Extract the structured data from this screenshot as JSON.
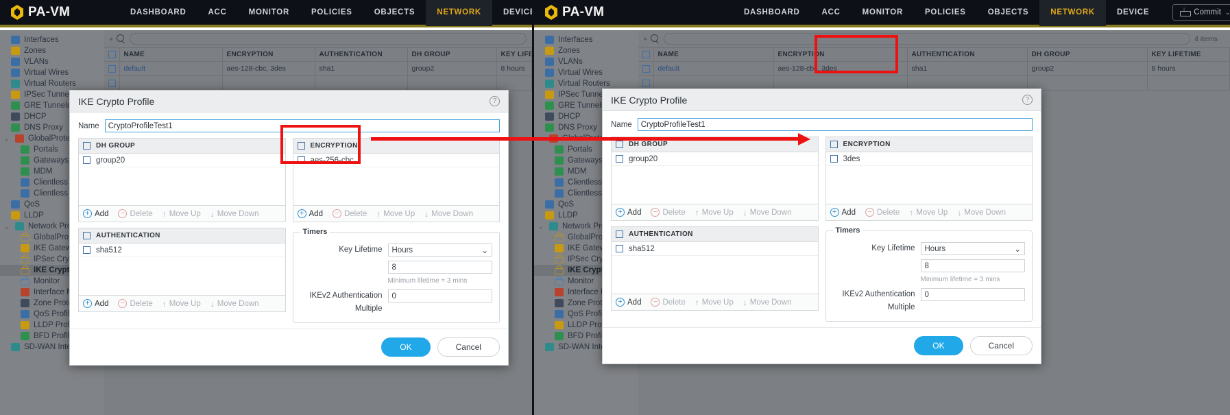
{
  "nav": {
    "brand": "PA-VM",
    "tabs": [
      "DASHBOARD",
      "ACC",
      "MONITOR",
      "POLICIES",
      "OBJECTS",
      "NETWORK",
      "DEVICE"
    ],
    "active_tab": "NETWORK",
    "commit_label": "Commit",
    "commit_caret": "⌄",
    "separator": "|"
  },
  "sidebar": {
    "items": [
      {
        "label": "Interfaces",
        "level": 0,
        "icon": "interfaces-icon",
        "color": "ic-blue"
      },
      {
        "label": "Zones",
        "level": 0,
        "icon": "zones-icon",
        "color": "ic-gold"
      },
      {
        "label": "VLANs",
        "level": 0,
        "icon": "vlans-icon",
        "color": "ic-blue"
      },
      {
        "label": "Virtual Wires",
        "level": 0,
        "icon": "virtual-wires-icon",
        "color": "ic-blue"
      },
      {
        "label": "Virtual Routers",
        "level": 0,
        "icon": "virtual-routers-icon",
        "color": "ic-teal"
      },
      {
        "label": "IPSec Tunnels",
        "level": 0,
        "icon": "ipsec-tunnels-icon",
        "color": "ic-gold"
      },
      {
        "label": "GRE Tunnels",
        "level": 0,
        "icon": "gre-tunnels-icon",
        "color": "ic-green"
      },
      {
        "label": "DHCP",
        "level": 0,
        "icon": "dhcp-icon",
        "color": "ic-dk"
      },
      {
        "label": "DNS Proxy",
        "level": 0,
        "icon": "dns-proxy-icon",
        "color": "ic-green"
      },
      {
        "label": "GlobalProtect",
        "level": 0,
        "icon": "globalprotect-icon",
        "color": "ic-red",
        "chevron": "⌄"
      },
      {
        "label": "Portals",
        "level": 1,
        "icon": "portals-icon",
        "color": "ic-green"
      },
      {
        "label": "Gateways",
        "level": 1,
        "icon": "gateways-icon",
        "color": "ic-green"
      },
      {
        "label": "MDM",
        "level": 1,
        "icon": "mdm-icon",
        "color": "ic-green"
      },
      {
        "label": "Clientless Ap",
        "level": 1,
        "icon": "clientless-apps-icon",
        "color": "ic-blue"
      },
      {
        "label": "Clientless Ap",
        "level": 1,
        "icon": "clientless-app-groups-icon",
        "color": "ic-blue"
      },
      {
        "label": "QoS",
        "level": 0,
        "icon": "qos-icon",
        "color": "ic-blue"
      },
      {
        "label": "LLDP",
        "level": 0,
        "icon": "lldp-icon",
        "color": "ic-gold"
      },
      {
        "label": "Network Profiles",
        "level": 0,
        "icon": "network-profiles-icon",
        "color": "ic-teal",
        "chevron": "⌄"
      },
      {
        "label": "GlobalProtec",
        "level": 1,
        "icon": "globalprotect-ipsec-crypto-icon",
        "color": "ic-lock"
      },
      {
        "label": "IKE Gateway",
        "level": 1,
        "icon": "ike-gateway-icon",
        "color": "ic-gold"
      },
      {
        "label": "IPSec Crypto",
        "level": 1,
        "icon": "ipsec-crypto-icon",
        "color": "ic-lock"
      },
      {
        "label": "IKE Crypto",
        "level": 1,
        "icon": "ike-crypto-icon",
        "color": "ic-lock",
        "selected": true
      },
      {
        "label": "Monitor",
        "level": 1,
        "icon": "monitor-icon",
        "color": "ic-lock-blue"
      },
      {
        "label": "Interface Mg",
        "level": 1,
        "icon": "interface-mgmt-icon",
        "color": "ic-red"
      },
      {
        "label": "Zone Protect",
        "level": 1,
        "icon": "zone-protection-icon",
        "color": "ic-dk"
      },
      {
        "label": "QoS Profile",
        "level": 1,
        "icon": "qos-profile-icon",
        "color": "ic-blue"
      },
      {
        "label": "LLDP Profile",
        "level": 1,
        "icon": "lldp-profile-icon",
        "color": "ic-gold"
      },
      {
        "label": "BFD Profile",
        "level": 1,
        "icon": "bfd-profile-icon",
        "color": "ic-green"
      },
      {
        "label": "SD-WAN Interface Profile",
        "level": 0,
        "icon": "sdwan-interface-profile-icon",
        "color": "ic-teal"
      }
    ]
  },
  "background_table": {
    "search_placeholder": "",
    "items_count": "4 items",
    "columns": [
      "NAME",
      "ENCRYPTION",
      "AUTHENTICATION",
      "DH GROUP",
      "KEY LIFETIME"
    ],
    "rows": [
      [
        "default",
        "aes-128-cbc, 3des",
        "sha1",
        "group2",
        "8 hours"
      ]
    ]
  },
  "dialog_left": {
    "title": "IKE Crypto Profile",
    "help_glyph": "?",
    "name_label": "Name",
    "name_value": "CryptoProfileTest1",
    "dh_group": {
      "header": "DH GROUP",
      "rows": [
        "group20"
      ]
    },
    "encryption": {
      "header": "ENCRYPTION",
      "rows": [
        "aes-256-cbc"
      ]
    },
    "authentication": {
      "header": "AUTHENTICATION",
      "rows": [
        "sha512"
      ]
    },
    "actions": {
      "add": "Add",
      "delete": "Delete",
      "move_up": "Move Up",
      "move_down": "Move Down",
      "add_glyph": "+",
      "delete_glyph": "−",
      "up_glyph": "↑",
      "down_glyph": "↓"
    },
    "timers": {
      "legend": "Timers",
      "key_lifetime_label": "Key Lifetime",
      "key_lifetime_unit": "Hours",
      "key_lifetime_unit_caret": "⌄",
      "key_lifetime_value": "8",
      "hint": "Minimum lifetime = 3 mins",
      "ikev2_label": "IKEv2 Authentication Multiple",
      "ikev2_value": "0"
    },
    "ok_label": "OK",
    "cancel_label": "Cancel"
  },
  "dialog_right": {
    "title": "IKE Crypto Profile",
    "help_glyph": "?",
    "name_label": "Name",
    "name_value": "CryptoProfileTest1",
    "dh_group": {
      "header": "DH GROUP",
      "rows": [
        "group20"
      ]
    },
    "encryption": {
      "header": "ENCRYPTION",
      "rows": [
        "3des"
      ]
    },
    "authentication": {
      "header": "AUTHENTICATION",
      "rows": [
        "sha512"
      ]
    },
    "actions": {
      "add": "Add",
      "delete": "Delete",
      "move_up": "Move Up",
      "move_down": "Move Down",
      "add_glyph": "+",
      "delete_glyph": "−",
      "up_glyph": "↑",
      "down_glyph": "↓"
    },
    "timers": {
      "legend": "Timers",
      "key_lifetime_label": "Key Lifetime",
      "key_lifetime_unit": "Hours",
      "key_lifetime_unit_caret": "⌄",
      "key_lifetime_value": "8",
      "hint": "Minimum lifetime = 3 mins",
      "ikev2_label": "IKEv2 Authentication Multiple",
      "ikev2_value": "0"
    },
    "ok_label": "OK",
    "cancel_label": "Cancel"
  },
  "annotation": {
    "highlight_color": "#ee1111",
    "description": "red rectangle around ENCRYPTION list in both dialogs with arrow pointing right"
  }
}
